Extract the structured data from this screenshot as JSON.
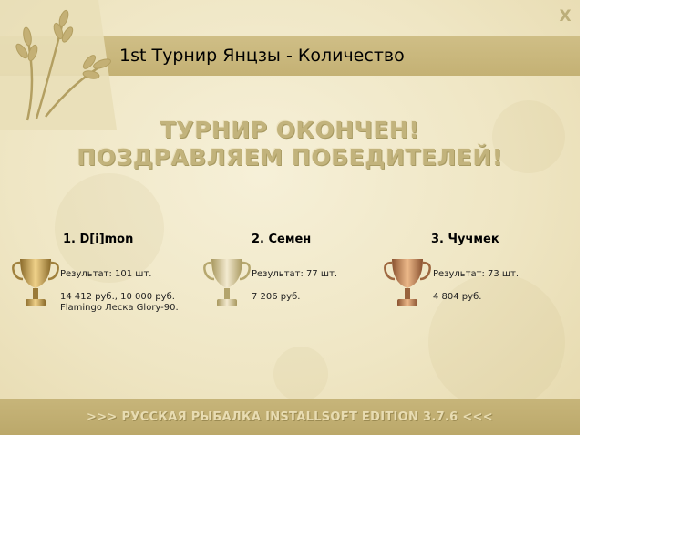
{
  "window": {
    "title": "1st Турнир Янцзы - Количество",
    "close_label": "X"
  },
  "headline": {
    "line1": "ТУРНИР ОКОНЧЕН!",
    "line2": "ПОЗДРАВЛЯЕМ ПОБЕДИТЕЛЕЙ!"
  },
  "winners": [
    {
      "name": "1. D[i]mon",
      "result": "Результат: 101 шт.",
      "prize": "14 412 руб., 10 000 руб.",
      "prize2": "Flamingo Леска Glory-90.",
      "trophy": "gold-cup-icon",
      "trophy_color": "#c9a04a"
    },
    {
      "name": "2. Семен",
      "result": "Результат: 77 шт.",
      "prize": "7 206 руб.",
      "prize2": "",
      "trophy": "silver-cup-icon",
      "trophy_color": "#cdbb85"
    },
    {
      "name": "3. Чучмек",
      "result": "Результат: 73 шт.",
      "prize": "4 804 руб.",
      "prize2": "",
      "trophy": "bronze-cup-icon",
      "trophy_color": "#c08a5a"
    }
  ],
  "footer": {
    "text": ">>> РУССКАЯ РЫБАЛКА INSTALLSOFT EDITION 3.7.6 <<<"
  },
  "colors": {
    "panel": "#efe6c4",
    "bar": "#c4b174"
  }
}
